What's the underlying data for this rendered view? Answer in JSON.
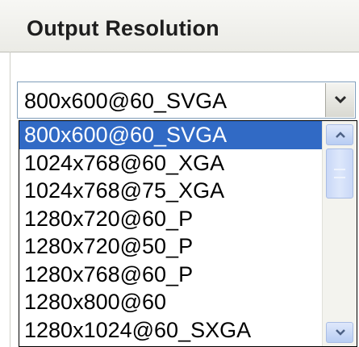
{
  "section": {
    "title": "Output Resolution"
  },
  "combo": {
    "selected": "800x600@60_SVGA",
    "icon": "chevron-down-icon"
  },
  "dropdown": {
    "items": [
      {
        "label": "800x600@60_SVGA",
        "selected": true
      },
      {
        "label": "1024x768@60_XGA",
        "selected": false
      },
      {
        "label": "1024x768@75_XGA",
        "selected": false
      },
      {
        "label": "1280x720@60_P",
        "selected": false
      },
      {
        "label": "1280x720@50_P",
        "selected": false
      },
      {
        "label": "1280x768@60_P",
        "selected": false
      },
      {
        "label": "1280x800@60",
        "selected": false
      },
      {
        "label": "1280x1024@60_SXGA",
        "selected": false
      }
    ],
    "scrollbar": {
      "up_icon": "scroll-up-arrow-icon",
      "down_icon": "scroll-down-arrow-icon"
    }
  },
  "colors": {
    "selection": "#316ac5",
    "border": "#7f9db9"
  }
}
